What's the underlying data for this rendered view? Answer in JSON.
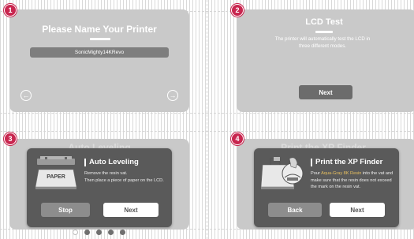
{
  "steps": [
    {
      "number": "1",
      "title": "Please Name Your Printer",
      "printer_name": "SonicMighty14KRevo",
      "prev_icon": "arrow-left-circle-icon",
      "next_icon": "arrow-right-circle-icon"
    },
    {
      "number": "2",
      "title": "LCD Test",
      "description_line1": "The printer will automatically test the LCD in",
      "description_line2": "three different modes.",
      "next_label": "Next"
    },
    {
      "number": "3",
      "background_title": "Auto Leveling",
      "dialog_title": "Auto Leveling",
      "text_line1": "Remove the resin vat.",
      "text_line2": "Then place a piece of paper on the LCD.",
      "paper_label": "PAPER",
      "stop_label": "Stop",
      "next_label": "Next",
      "pagination_total": 5,
      "pagination_active": 1
    },
    {
      "number": "4",
      "background_title": "Print the XP Finder",
      "dialog_title": "Print the XP Finder",
      "text_pre": "Pour ",
      "text_highlight": "Aqua-Gray 8K Resin",
      "text_post": " into the vat and",
      "text_line2": "make sure that the resin does not exceed",
      "text_line3": "the mark on the resin vat.",
      "back_label": "Back",
      "next_label": "Next"
    }
  ],
  "colors": {
    "badge": "#c8264f",
    "panel": "#c9c9c9",
    "dialog": "#5a5a5a",
    "highlight": "#e8c060"
  }
}
